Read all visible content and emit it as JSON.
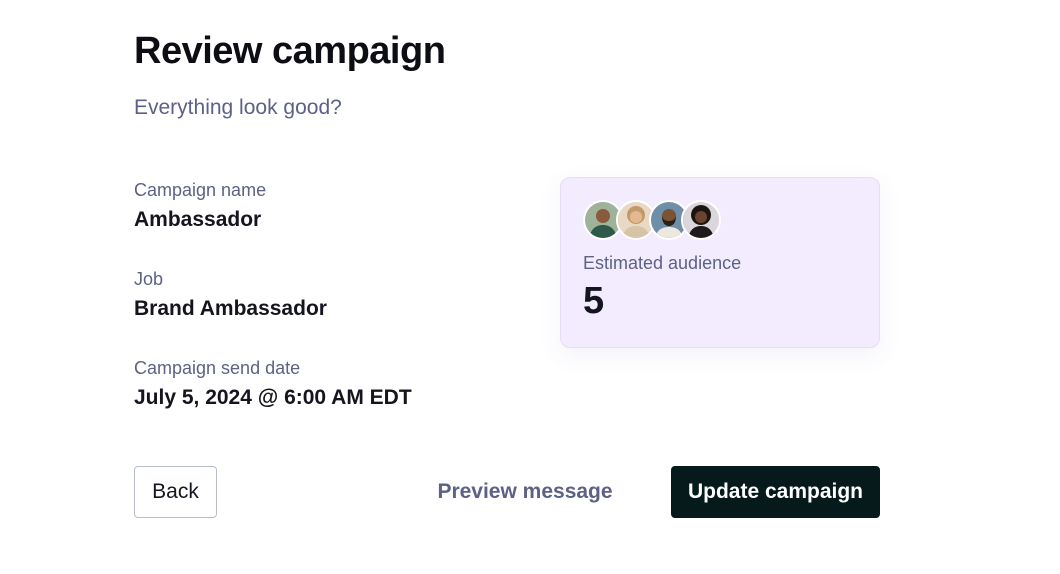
{
  "header": {
    "title": "Review campaign",
    "subtitle": "Everything look good?"
  },
  "fields": {
    "campaign_name": {
      "label": "Campaign name",
      "value": "Ambassador"
    },
    "job": {
      "label": "Job",
      "value": "Brand Ambassador"
    },
    "send_date": {
      "label": "Campaign send date",
      "value": "July 5, 2024 @ 6:00 AM EDT"
    }
  },
  "audience": {
    "label": "Estimated audience",
    "count": "5",
    "avatars": [
      "avatar-1",
      "avatar-2",
      "avatar-3",
      "avatar-4"
    ]
  },
  "actions": {
    "back_label": "Back",
    "preview_label": "Preview message",
    "update_label": "Update campaign"
  },
  "colors": {
    "card_background": "#f3ecfe",
    "primary_button": "#06191b",
    "muted_text": "#5d6186"
  }
}
